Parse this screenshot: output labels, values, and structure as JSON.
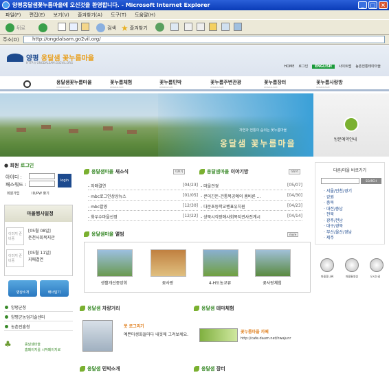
{
  "window": {
    "title": "양평옹달샘꽃누름마을에 오신것을 환영합니다. - Microsoft Internet Explorer"
  },
  "menu": [
    "파일(F)",
    "편집(E)",
    "보기(V)",
    "즐겨찾기(A)",
    "도구(T)",
    "도움말(H)"
  ],
  "toolbar": {
    "back_label": "뒤로",
    "search_label": "검색",
    "favorites_label": "즐겨찾기"
  },
  "address": {
    "label": "주소(D)",
    "url": "http://ongdalsam.go2vil.org/"
  },
  "site": {
    "logo_prefix": "양평",
    "logo_name": "옹달샘 꽃누름마을",
    "logo_sub": "HTTP:// ONGDALSAM.GO2VIL.ORG",
    "top_links": [
      "HOME",
      "로그인",
      "ENGLISH",
      "사이트맵",
      "농촌전통테마마을"
    ]
  },
  "nav": [
    {
      "label": "옹달샘꽃누름마을",
      "sub": "ONGDALSAM"
    },
    {
      "label": "꽃누름체험",
      "sub": "ONGDALSAM"
    },
    {
      "label": "꽃누름민박",
      "sub": "ONGDALSAM"
    },
    {
      "label": "꽃누름주변관광",
      "sub": "ONGDALSAM"
    },
    {
      "label": "꽃누름장터",
      "sub": "ONGDALSAM"
    },
    {
      "label": "꽃누름사랑방",
      "sub": "ONGDALSAM"
    }
  ],
  "banner": {
    "subtitle": "자연과 전통이 숨쉬는 꽃누름마을",
    "title": "옹달샘 꽃누름마을"
  },
  "visit": {
    "label": "방문예약안내"
  },
  "login": {
    "title_a": "회원",
    "title_b": "로그인",
    "id_label": "아이디 :",
    "pw_label": "패스워드 :",
    "button": "login",
    "join": "회원가입",
    "find": "ID/PW 찾기"
  },
  "schedule": {
    "title": "마을행사일정",
    "placeholder": "이미지 준비중",
    "items": [
      {
        "date": "[05월 08일]",
        "text": "춘천사회복지관"
      },
      {
        "date": "[05월 11일]",
        "text": "지매결연"
      }
    ]
  },
  "left_buttons": [
    "영상소개",
    "배너달기"
  ],
  "left_links": [
    "양평군청",
    "양평군농업기술센터",
    "농촌진흥청"
  ],
  "left_promo": {
    "line1": "옹달샘마을",
    "line2": "홈페이지를 시작페이지로"
  },
  "news": {
    "title_a": "옹달샘마을",
    "title_b": "새소식",
    "more": "더보기",
    "items": [
      {
        "text": "- 자매결연",
        "date": "[04/23]"
      },
      {
        "text": "- mbc로그인상상뉴스",
        "date": "[01/05]"
      },
      {
        "text": "- mbc촬영",
        "date": "[12/30]"
      },
      {
        "text": "- 화우수마을선정",
        "date": "[12/22]"
      }
    ]
  },
  "story": {
    "title_a": "옹달샘마을",
    "title_b": "이야기방",
    "more": "더보기",
    "items": [
      {
        "text": "- 마을견경",
        "date": "[05/07]"
      },
      {
        "text": "- 콘이긴돈-건통목공예의 흠바른 ...",
        "date": "[04/30]"
      },
      {
        "text": "- 다문초등학교벤표유치원",
        "date": "[04/23]"
      },
      {
        "text": "- 상북시각장애사회복지관사진계시",
        "date": "[04/14]"
      }
    ]
  },
  "album": {
    "title_a": "옹달샘마을",
    "title_b": "앨범",
    "more": "more",
    "items": [
      "생활개선중앙회",
      "꽃사랑",
      "4-H도농교류",
      "꽃사랑체험"
    ]
  },
  "bottom": {
    "road": {
      "title_a": "옹달샘",
      "title_b": "차량거리",
      "heading": "못 로그리기",
      "text": "예쁜마생화들마다 내옷에 그려보세요."
    },
    "theme": {
      "title_a": "옹달샘",
      "title_b": "테마체험",
      "heading": "꽃누름마을 카페",
      "text": "http://cafe.daum.net/hwajunr"
    },
    "homestay": {
      "title_a": "옹달샘",
      "title_b": "민박소개"
    },
    "market": {
      "title_a": "옹달샘",
      "title_b": "장터"
    }
  },
  "region": {
    "title": "다른/마을 바로가기",
    "search": "SEARCH",
    "items": [
      "· 서울/인천/경기",
      "· 강원",
      "· 충북",
      "· 대전/충남",
      "· 전북",
      "· 광주/전남",
      "· 대구/경북",
      "· 부산/울산/경남",
      "· 제주"
    ]
  },
  "right_icons": [
    "마을휴나위",
    "마을통영상",
    "오시는길"
  ]
}
